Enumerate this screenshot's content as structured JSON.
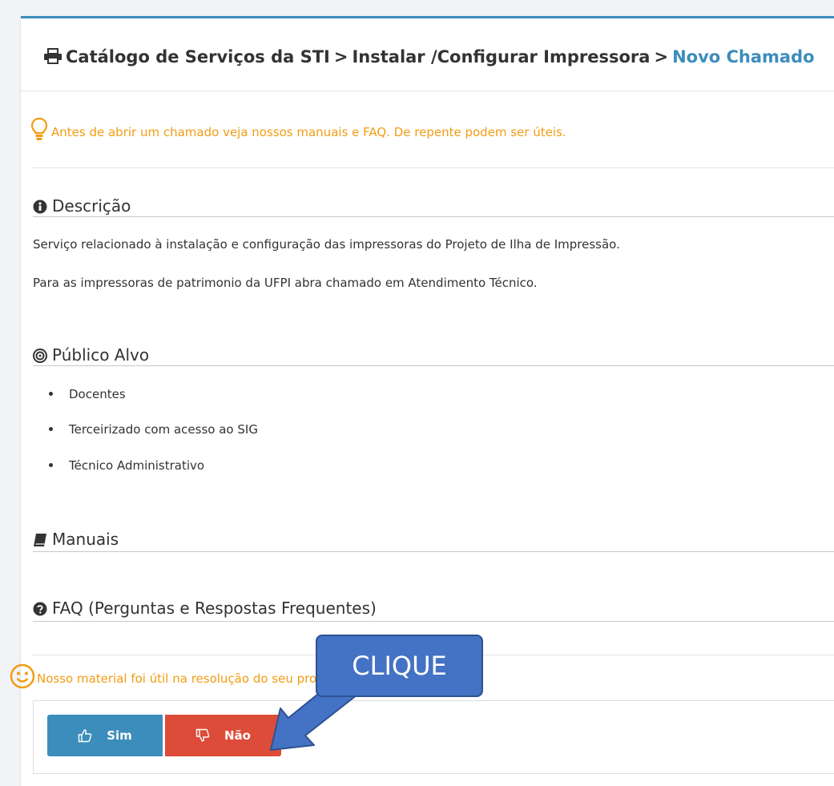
{
  "breadcrumb": {
    "items": [
      "Catálogo de Serviços da STI",
      "Instalar /Configurar Impressora",
      "Novo Chamado"
    ],
    "separator": ">"
  },
  "tip": "Antes de abrir um chamado veja nossos manuais e FAQ. De repente podem ser úteis.",
  "descricao": {
    "title": "Descrição",
    "lines": [
      "Serviço relacionado à instalação e configuração das impressoras do Projeto de Ilha de Impressão.",
      "Para as impressoras de patrimonio da UFPI abra chamado em Atendimento Técnico."
    ]
  },
  "publico": {
    "title": "Público Alvo",
    "items": [
      "Docentes",
      "Terceirizado com acesso ao SIG",
      "Técnico Administrativo"
    ]
  },
  "manuais": {
    "title": "Manuais"
  },
  "faq": {
    "title": "FAQ (Perguntas e Respostas Frequentes)"
  },
  "feedback": {
    "question": "Nosso material foi útil na resolução do seu problema?",
    "yes_label": "Sim",
    "no_label": "Não"
  },
  "annotation": {
    "label": "CLIQUE"
  },
  "colors": {
    "accent": "#3c8dbc",
    "warning": "#f39c12",
    "danger": "#dd4b39",
    "callout": "#4472c4"
  }
}
